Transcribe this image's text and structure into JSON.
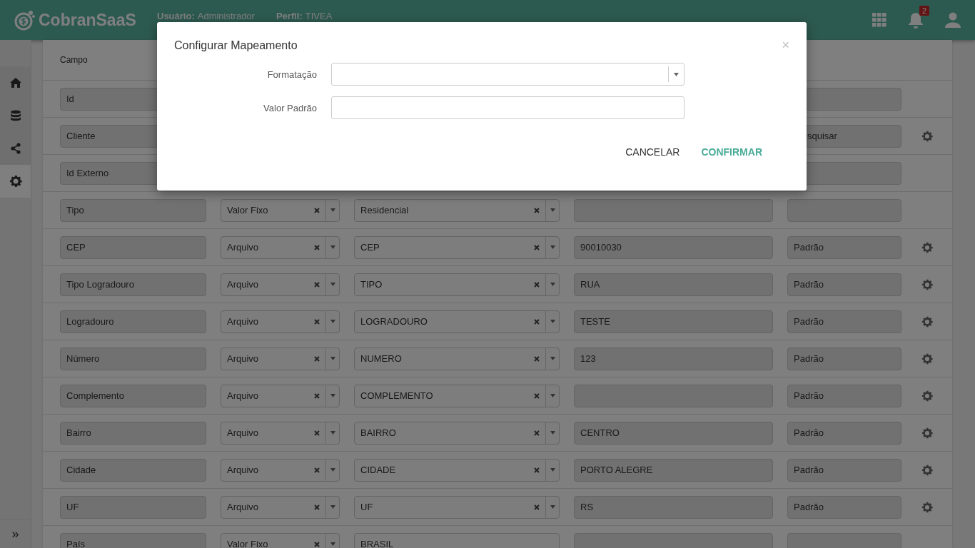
{
  "header": {
    "brand": "CobranSaaS",
    "user_label": "Usuário:",
    "user_value": "Administrador",
    "profile_label": "Perfil:",
    "profile_value": "TIVEA",
    "notification_count": "2"
  },
  "sidebar": {
    "items": [
      {
        "selected": false
      },
      {
        "selected": false
      },
      {
        "selected": false
      },
      {
        "selected": true
      }
    ],
    "expand": "»"
  },
  "table": {
    "columns": [
      "Campo"
    ],
    "rows": [
      {
        "field": "Id",
        "source": null,
        "value": null,
        "text": "",
        "default": "",
        "settings": false
      },
      {
        "field": "Cliente",
        "source": null,
        "value": null,
        "text": "",
        "default": "squisar",
        "partly_hidden": true,
        "settings": true
      },
      {
        "field": "Id Externo",
        "source": null,
        "value": null,
        "text": "",
        "default": "",
        "settings": false
      },
      {
        "field": "Tipo",
        "source": "Valor Fixo",
        "value": {
          "kind": "select",
          "text": "Residencial"
        },
        "text": "",
        "default": "",
        "settings": false
      },
      {
        "field": "CEP",
        "source": "Arquivo",
        "value": {
          "kind": "select",
          "text": "CEP"
        },
        "text": "90010030",
        "default": "Padrão",
        "partly_hidden": false,
        "settings": true
      },
      {
        "field": "Tipo Logradouro",
        "source": "Arquivo",
        "value": {
          "kind": "select",
          "text": "TIPO"
        },
        "text": "RUA",
        "default": "Padrão",
        "partly_hidden": false,
        "settings": true
      },
      {
        "field": "Logradouro",
        "source": "Arquivo",
        "value": {
          "kind": "select",
          "text": "LOGRADOURO"
        },
        "text": "TESTE",
        "default": "Padrão",
        "partly_hidden": false,
        "settings": true
      },
      {
        "field": "Número",
        "source": "Arquivo",
        "value": {
          "kind": "select",
          "text": "NUMERO"
        },
        "text": "123",
        "default": "Padrão",
        "partly_hidden": false,
        "settings": true
      },
      {
        "field": "Complemento",
        "source": "Arquivo",
        "value": {
          "kind": "select",
          "text": "COMPLEMENTO"
        },
        "text": "",
        "default": "Padrão",
        "partly_hidden": false,
        "settings": true
      },
      {
        "field": "Bairro",
        "source": "Arquivo",
        "value": {
          "kind": "select",
          "text": "BAIRRO"
        },
        "text": "CENTRO",
        "default": "Padrão",
        "partly_hidden": false,
        "settings": true
      },
      {
        "field": "Cidade",
        "source": "Arquivo",
        "value": {
          "kind": "select",
          "text": "CIDADE"
        },
        "text": "PORTO ALEGRE",
        "default": "Padrão",
        "partly_hidden": false,
        "settings": true
      },
      {
        "field": "UF",
        "source": "Arquivo",
        "value": {
          "kind": "select",
          "text": "UF"
        },
        "text": "RS",
        "default": "Padrão",
        "partly_hidden": false,
        "settings": true
      },
      {
        "field": "País",
        "source": "Valor Fixo",
        "value": {
          "kind": "text",
          "text": "BRASIL"
        },
        "text": "",
        "default": "",
        "settings": false
      }
    ]
  },
  "modal": {
    "title": "Configurar Mapeamento",
    "close": "×",
    "fields": [
      {
        "label": "Formatação",
        "kind": "select"
      },
      {
        "label": "Valor Padrão",
        "kind": "text"
      }
    ],
    "buttons": [
      {
        "label": "CANCELAR",
        "primary": false
      },
      {
        "label": "CONFIRMAR",
        "primary": true
      }
    ]
  }
}
